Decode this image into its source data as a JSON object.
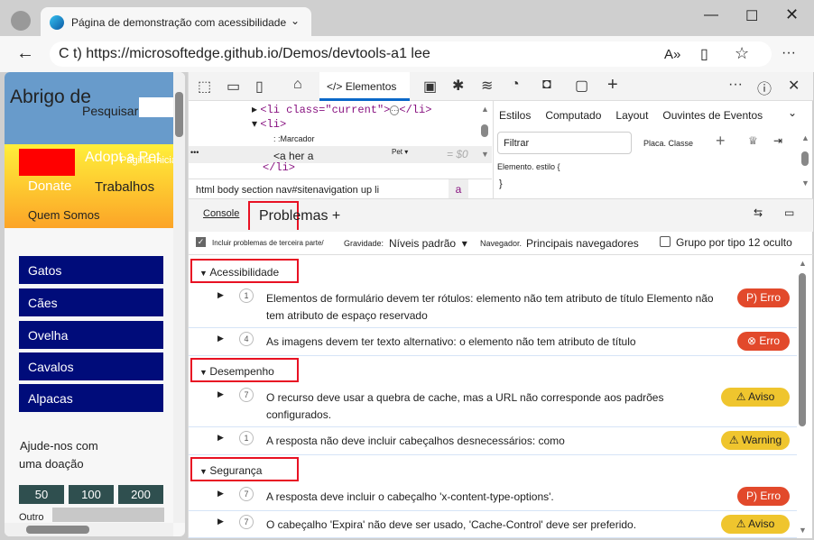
{
  "browser": {
    "tab_title": "Página de demonstração com acessibilidade",
    "url": "C t) https://microsoftedge.github.io/Demos/devtools-a1 lee"
  },
  "page": {
    "title": "Abrigo de",
    "search": "Pesquisar",
    "nav": [
      "Adopt a Pet",
      "Página Inicial",
      "Donate",
      "Trabalhos",
      "Quem Somos"
    ],
    "animals": [
      "Gatos",
      "Cães",
      "Ovelha",
      "Cavalos",
      "Alpacas"
    ],
    "donate_text": [
      "Ajude-nos com",
      "uma doação"
    ],
    "amounts": [
      "50",
      "100",
      "200"
    ],
    "other": "Outro"
  },
  "devtools": {
    "elements_tab": "Elementos",
    "dom": {
      "line1": "<li class=\"current\">",
      "line1_end": "</li>",
      "line2": "<li>",
      "marker": ": :Marcador",
      "line4": "<a her a",
      "pet": "Pet ▾",
      "eq": "= $0",
      "line5": "</li>",
      "breadcrumb": "html body section nav#sitenavigation up li",
      "crumb_a": "a"
    },
    "styles": {
      "tabs": [
        "Estilos",
        "Computado",
        "Layout",
        "Ouvintes de Eventos"
      ],
      "filter_placeholder": "Filtrar",
      "cls": "Placa. Classe",
      "rule": "Elemento. estilo {",
      "close": "}"
    },
    "drawer": {
      "console": "Console",
      "issues": "Problemas +"
    },
    "filters": {
      "third_party": "Incluir problemas de terceira parte/",
      "severity_label": "Gravidade:",
      "severity": "Níveis padrão",
      "browser_label": "Navegador.",
      "browser": "Principais navegadores",
      "group": "Grupo por tipo 12 oculto"
    },
    "groups": [
      {
        "name": "Acessibilidade",
        "issues": [
          {
            "count": "1",
            "text": "Elementos de formulário devem ter rótulos: elemento não tem atributo de título Elemento não tem atributo de espaço reservado",
            "badge": "P) Erro",
            "kind": "error"
          },
          {
            "count": "4",
            "text": "As imagens devem ter texto alternativo: o elemento não tem atributo de título",
            "badge": "⊗ Erro",
            "kind": "error"
          }
        ]
      },
      {
        "name": "Desempenho",
        "issues": [
          {
            "count": "7",
            "text": "O recurso deve usar a quebra de cache, mas a URL não corresponde aos padrões configurados.",
            "badge": "⚠ Aviso",
            "kind": "warning"
          },
          {
            "count": "1",
            "text": "A resposta não deve incluir cabeçalhos desnecessários: como",
            "badge": "⚠ Warning",
            "kind": "warning"
          }
        ]
      },
      {
        "name": "Segurança",
        "issues": [
          {
            "count": "7",
            "text": "A resposta deve incluir o cabeçalho 'x-content-type-options'.",
            "badge": "P) Erro",
            "kind": "error"
          },
          {
            "count": "7",
            "text": "O cabeçalho 'Expira' não deve ser usado, 'Cache-Control' deve ser preferido.",
            "badge": "⚠ Aviso",
            "kind": "warning"
          }
        ]
      }
    ]
  },
  "colors": {
    "error": "#e2492b",
    "warning": "#efc52e",
    "nav": "#000c7a",
    "highlight": "#e81123"
  }
}
